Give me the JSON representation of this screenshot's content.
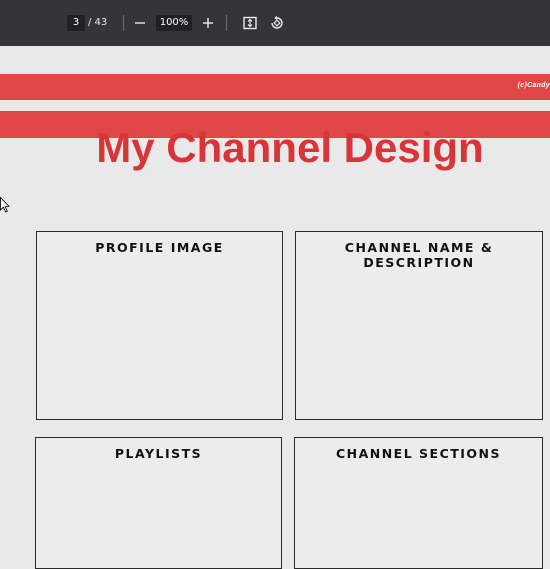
{
  "toolbar": {
    "page_current": "3",
    "page_total": "/ 43",
    "zoom": "100%",
    "icons": [
      "zoom-out-icon",
      "zoom-in-icon",
      "fit-page-icon",
      "rotate-icon"
    ]
  },
  "document": {
    "brand_text": "(c)Candy",
    "title": "My Channel Design",
    "boxes": [
      {
        "label": "PROFILE IMAGE"
      },
      {
        "label": "CHANNEL NAME & DESCRIPTION"
      },
      {
        "label": "PLAYLISTS"
      },
      {
        "label": "CHANNEL SECTIONS"
      }
    ]
  },
  "colors": {
    "toolbar_bg": "#333639",
    "accent_red": "#e04848",
    "title_red": "#d93438",
    "page_bg": "#e9e9e9"
  }
}
